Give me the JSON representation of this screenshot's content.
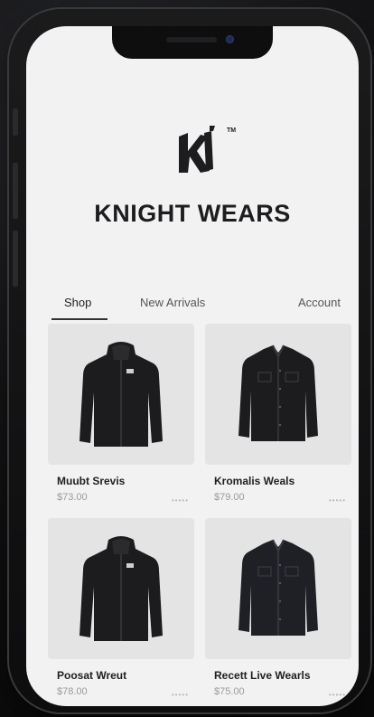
{
  "brand": {
    "name": "KNIGHT WEARS",
    "logo_icon": "knight-wears-logo-icon",
    "trademark": "TM"
  },
  "tabs": [
    {
      "label": "Shop",
      "active": true
    },
    {
      "label": "New Arrivals",
      "active": false
    },
    {
      "label": "Account",
      "active": false
    }
  ],
  "products": [
    {
      "name": "Muubt Srevis",
      "price": "$73.00",
      "rating": "•••••",
      "image_icon": "hooded-jacket-icon"
    },
    {
      "name": "Kromalis Weals",
      "price": "$79.00",
      "rating": "•••••",
      "image_icon": "denim-jacket-icon"
    },
    {
      "name": "Poosat Wreut",
      "price": "$78.00",
      "rating": "•••••",
      "image_icon": "hooded-jacket-icon"
    },
    {
      "name": "Recett Live Wearls",
      "price": "$75.00",
      "rating": "•••••",
      "image_icon": "denim-jacket-icon"
    }
  ],
  "colors": {
    "screen_bg": "#f2f2f2",
    "card_bg": "#e4e4e4",
    "text_primary": "#1d1d1f",
    "text_muted": "#9a9a9a",
    "jacket": "#1c1c1e"
  }
}
